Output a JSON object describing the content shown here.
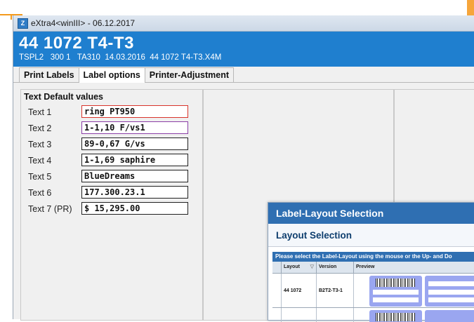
{
  "window": {
    "title": "eXtra4<winIII> - 06.12.2017",
    "icon": "app-icon"
  },
  "header": {
    "big_title": "44 1072 T4-T3",
    "subtitle": "TSPL2   300 1   TA310  14.03.2016  44 1072 T4-T3.X4M"
  },
  "tabs": [
    {
      "label": "Print Labels",
      "active": false
    },
    {
      "label": "Label options",
      "active": true
    },
    {
      "label": "Printer-Adjustment",
      "active": false
    }
  ],
  "text_defaults": {
    "title": "Text Default values",
    "rows": [
      {
        "label": "Text 1",
        "value": "ring PT950"
      },
      {
        "label": "Text 2",
        "value": "1-1,10 F/vs1"
      },
      {
        "label": "Text 3",
        "value": "89-0,67 G/vs"
      },
      {
        "label": "Text 4",
        "value": "1-1,69 saphire"
      },
      {
        "label": "Text 5",
        "value": "BlueDreams"
      },
      {
        "label": "Text 6",
        "value": "177.300.23.1"
      },
      {
        "label": "Text 7 (PR)",
        "value": "$ 15,295.00"
      }
    ]
  },
  "dialog": {
    "title": "Label-Layout Selection",
    "heading": "Layout Selection",
    "instruction": "Please select the Label-Layout using the mouse or the Up- and Do",
    "columns": [
      "Layout",
      "Version",
      "Preview"
    ],
    "rows": [
      {
        "layout": "44 1072",
        "version": "B2T2-T3-1"
      }
    ]
  },
  "colors": {
    "header_bg": "#1f7fcf",
    "dialog_title_bg": "#2f6fb2",
    "preview_label": "#9aa6f0",
    "accent_orange": "#f39a1d"
  }
}
